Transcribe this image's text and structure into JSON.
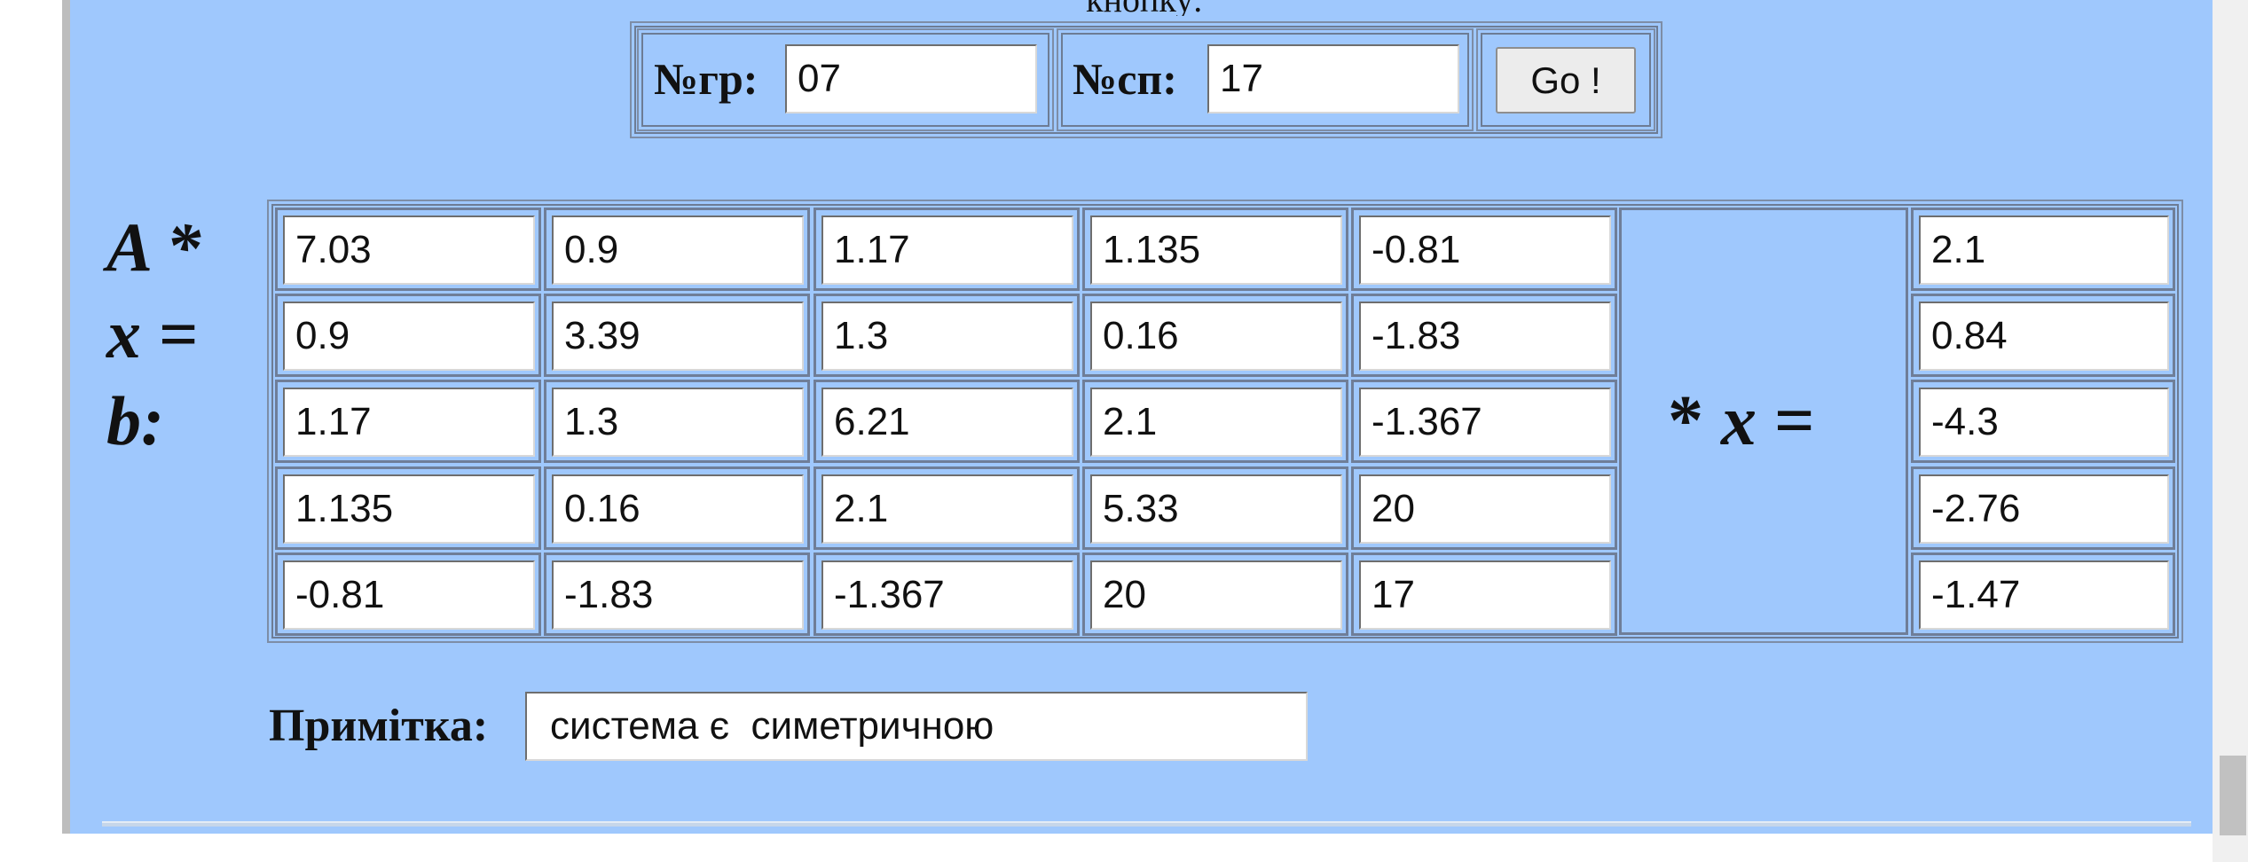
{
  "header": {
    "cut_text": "кнопку:",
    "group_label": "№гр:",
    "group_value": "07",
    "list_label": "№сп:",
    "list_value": "17",
    "go_label": "Go !"
  },
  "equation": {
    "lhs_label": "A *\nx =\nb:",
    "mid_star": "*",
    "mid_x": "x",
    "mid_eq": "="
  },
  "matrix": [
    [
      "7.03",
      "0.9",
      "1.17",
      "1.135",
      "-0.81"
    ],
    [
      "0.9",
      "3.39",
      "1.3",
      "0.16",
      "-1.83"
    ],
    [
      "1.17",
      "1.3",
      "6.21",
      "2.1",
      "-1.367"
    ],
    [
      "1.135",
      "0.16",
      "2.1",
      "5.33",
      "20"
    ],
    [
      "-0.81",
      "-1.83",
      "-1.367",
      "20",
      "17"
    ]
  ],
  "vector_b": [
    "2.1",
    "0.84",
    "-4.3",
    "-2.76",
    "-1.47"
  ],
  "note": {
    "label": "Примітка:",
    "value": "система є  симетричною"
  }
}
